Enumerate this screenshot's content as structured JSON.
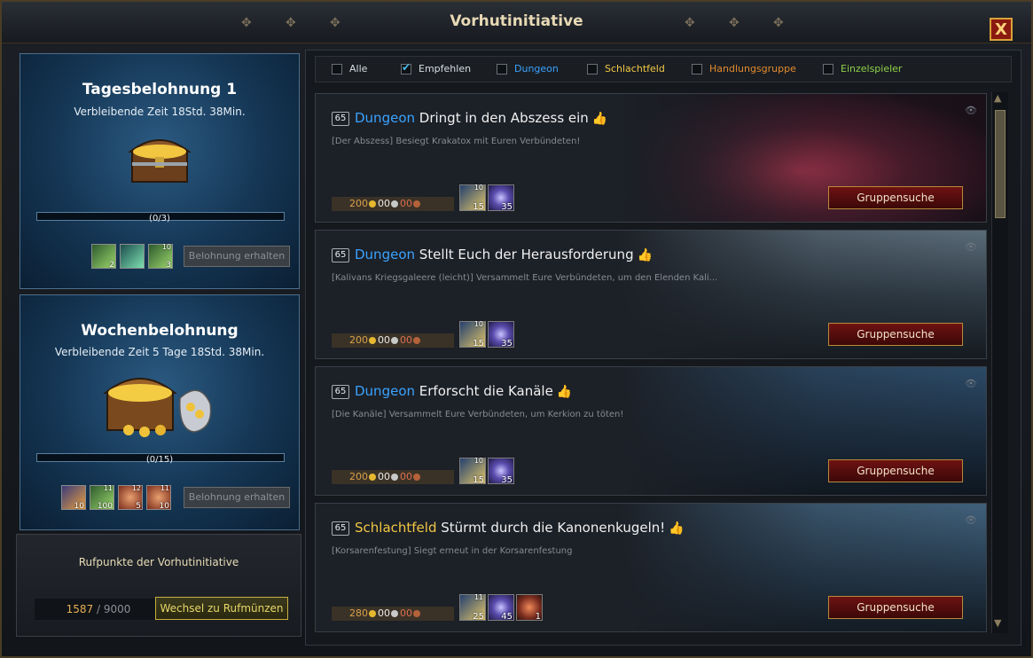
{
  "window": {
    "title": "Vorhutinitiative",
    "close_label": "X"
  },
  "daily": {
    "title": "Tagesbelohnung 1",
    "time": "Verbleibende Zeit 18Std. 38Min.",
    "progress_label": "(0/3)",
    "progress": 0,
    "items": [
      {
        "icon": "green-crystal-icon",
        "count": "2",
        "top": ""
      },
      {
        "icon": "green-orb-icon",
        "count": "",
        "top": ""
      },
      {
        "icon": "green-gem-icon",
        "count": "3",
        "top": "10"
      }
    ],
    "claim_label": "Belohnung erhalten"
  },
  "weekly": {
    "title": "Wochenbelohnung",
    "time": "Verbleibende Zeit 5 Tage 18Std. 38Min.",
    "progress_label": "(0/15)",
    "progress": 0,
    "items": [
      {
        "icon": "scroll-icon",
        "count": "10",
        "top": ""
      },
      {
        "icon": "green-crystal-icon",
        "count": "100",
        "top": "11"
      },
      {
        "icon": "red-coin-icon",
        "count": "5",
        "top": "12"
      },
      {
        "icon": "red-coin-icon",
        "count": "10",
        "top": "11"
      }
    ],
    "claim_label": "Belohnung erhalten"
  },
  "reputation": {
    "title": "Rufpunkte der Vorhutinitiative",
    "current": "1587",
    "max": " / 9000",
    "exchange_label": "Wechsel zu Rufmünzen"
  },
  "filters": [
    {
      "label": "Alle",
      "checked": false,
      "color": "#d8dde2"
    },
    {
      "label": "Empfehlen",
      "checked": true,
      "color": "#d8dde2"
    },
    {
      "label": "Dungeon",
      "checked": false,
      "color": "#3aa3ff"
    },
    {
      "label": "Schlachtfeld",
      "checked": false,
      "color": "#f2c744"
    },
    {
      "label": "Handlungsgruppe",
      "checked": false,
      "color": "#e38b2e"
    },
    {
      "label": "Einzelspieler",
      "checked": false,
      "color": "#8fd04a"
    }
  ],
  "entries": [
    {
      "level": "65",
      "type": "Dungeon",
      "title": "Dringt in den Abszess ein",
      "desc": "[Der Abszess] Besiegt Krakatox mit Euren Verbündeten!",
      "gold": "200",
      "silver": "00",
      "copper": "00",
      "rewards": [
        {
          "icon": "xp-scroll-icon",
          "top": "10",
          "count": "15"
        },
        {
          "icon": "vanguard-coin-icon",
          "top": "",
          "count": "35"
        }
      ],
      "button": "Gruppensuche",
      "bg": "lava"
    },
    {
      "level": "65",
      "type": "Dungeon",
      "title": "Stellt Euch der Herausforderung",
      "desc": "[Kalivans Kriegsgaleere (leicht)] Versammelt Eure Verbündeten, um den Elenden Kali...",
      "gold": "200",
      "silver": "00",
      "copper": "00",
      "rewards": [
        {
          "icon": "xp-scroll-icon",
          "top": "10",
          "count": "15"
        },
        {
          "icon": "vanguard-coin-icon",
          "top": "",
          "count": "35"
        }
      ],
      "button": "Gruppensuche",
      "bg": "ship"
    },
    {
      "level": "65",
      "type": "Dungeon",
      "title": "Erforscht die Kanäle",
      "desc": "[Die Kanäle] Versammelt Eure Verbündeten, um Kerkion zu töten!",
      "gold": "200",
      "silver": "00",
      "copper": "00",
      "rewards": [
        {
          "icon": "xp-scroll-icon",
          "top": "10",
          "count": "15"
        },
        {
          "icon": "vanguard-coin-icon",
          "top": "",
          "count": "35"
        }
      ],
      "button": "Gruppensuche",
      "bg": "canal"
    },
    {
      "level": "65",
      "type": "Schlachtfeld",
      "title": "Stürmt durch die Kanonenkugeln!",
      "desc": "[Korsarenfestung] Siegt erneut in der Korsarenfestung",
      "gold": "280",
      "silver": "00",
      "copper": "00",
      "rewards": [
        {
          "icon": "xp-scroll-icon",
          "top": "11",
          "count": "25"
        },
        {
          "icon": "vanguard-coin-icon",
          "top": "",
          "count": "45"
        },
        {
          "icon": "red-potion-icon",
          "top": "",
          "count": "1"
        }
      ],
      "button": "Gruppensuche",
      "bg": "fortress"
    }
  ]
}
